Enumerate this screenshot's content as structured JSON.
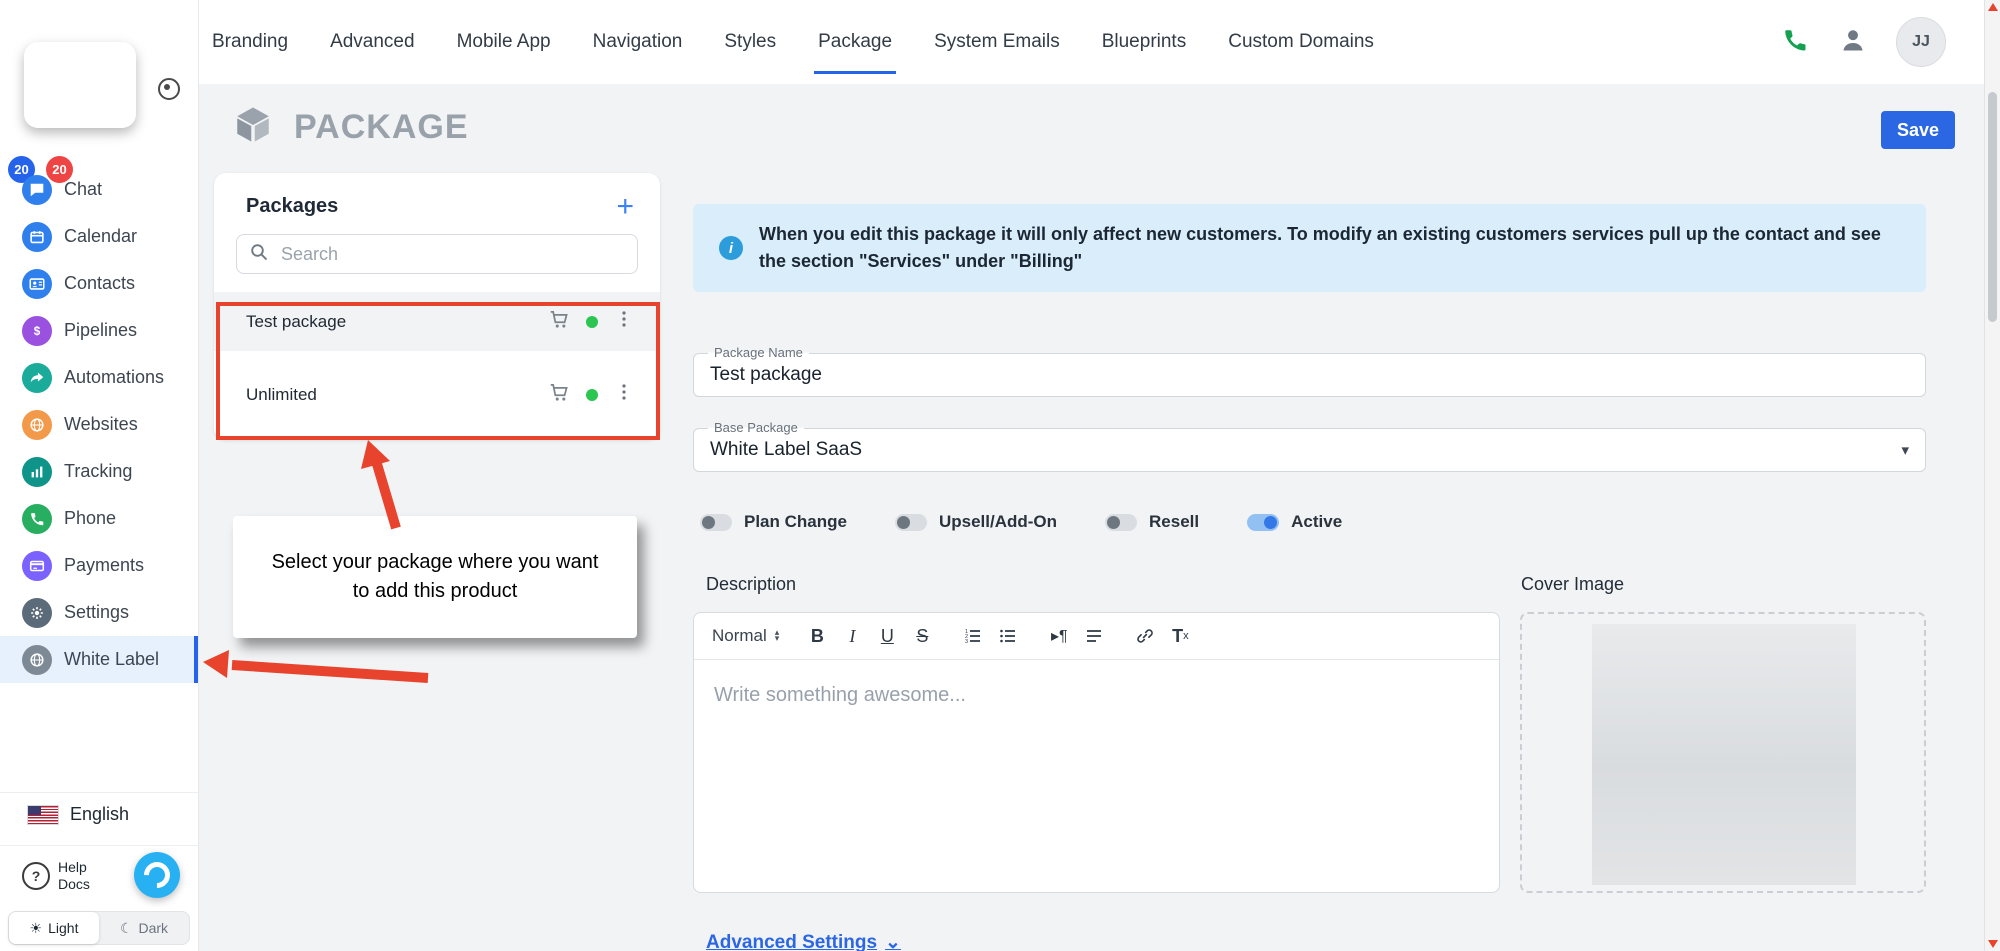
{
  "topnav": {
    "tabs": [
      "Branding",
      "Advanced",
      "Mobile App",
      "Navigation",
      "Styles",
      "Package",
      "System Emails",
      "Blueprints",
      "Custom Domains"
    ],
    "active_tab": "Package",
    "avatar_initials": "JJ"
  },
  "header": {
    "title": "PACKAGE",
    "save_button": "Save"
  },
  "sidebar": {
    "badge_blue": "20",
    "badge_red": "20",
    "items": [
      {
        "label": "Chat",
        "color": "#2f80ed"
      },
      {
        "label": "Calendar",
        "color": "#2f80ed"
      },
      {
        "label": "Contacts",
        "color": "#2f80ed"
      },
      {
        "label": "Pipelines",
        "color": "#9b51e0"
      },
      {
        "label": "Automations",
        "color": "#1aab9b"
      },
      {
        "label": "Websites",
        "color": "#f2994a"
      },
      {
        "label": "Tracking",
        "color": "#0e9488"
      },
      {
        "label": "Phone",
        "color": "#27ae60"
      },
      {
        "label": "Payments",
        "color": "#7b61ff"
      },
      {
        "label": "Settings",
        "color": "#5b6b79"
      },
      {
        "label": "White Label",
        "color": "#7d8a96"
      }
    ],
    "active_item": "White Label",
    "language": "English",
    "help_line1": "Help",
    "help_line2": "Docs",
    "theme_light": "Light",
    "theme_dark": "Dark"
  },
  "packages_panel": {
    "title": "Packages",
    "search_placeholder": "Search",
    "items": [
      {
        "name": "Test package",
        "selected": true
      },
      {
        "name": "Unlimited",
        "selected": false
      }
    ]
  },
  "annotation": {
    "callout_text": "Select your package where you want to add this product"
  },
  "content": {
    "alert_text": "When you edit this package it will only affect new customers. To modify an existing customers services pull up the contact and see the section \"Services\" under \"Billing\"",
    "package_name_label": "Package Name",
    "package_name_value": "Test package",
    "base_package_label": "Base Package",
    "base_package_value": "White Label SaaS",
    "toggles": [
      {
        "label": "Plan Change",
        "on": false
      },
      {
        "label": "Upsell/Add-On",
        "on": false
      },
      {
        "label": "Resell",
        "on": false
      },
      {
        "label": "Active",
        "on": true
      }
    ],
    "description_label": "Description",
    "cover_image_label": "Cover Image",
    "editor": {
      "format": "Normal",
      "bold": "B",
      "italic": "I",
      "underline": "U",
      "strike": "S",
      "clear": "Tx",
      "placeholder": "Write something awesome..."
    },
    "advanced_settings": "Advanced Settings"
  },
  "colors": {
    "accent_blue": "#2563eb",
    "annotation_red": "#e8432d",
    "alert_bg": "#d9edfb",
    "active_green": "#2bc550"
  }
}
